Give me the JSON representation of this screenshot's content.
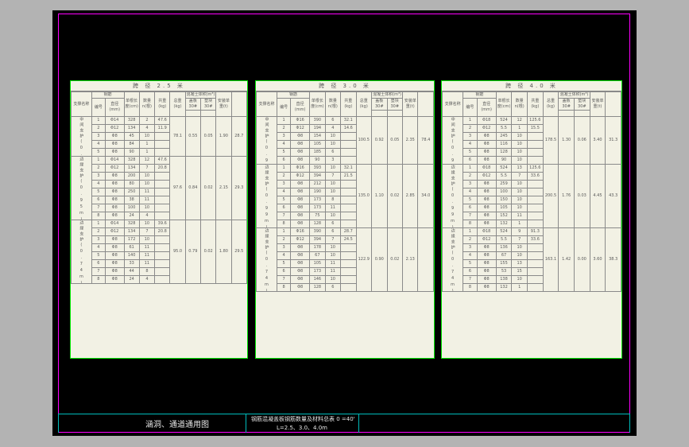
{
  "drawing": {
    "title": "涵洞、通道通用图",
    "subtitle_1": "钢筋混凝盖板钢筋数量及材料总表 0 =40'",
    "subtitle_2": "L=2.5、3.0、4.0m"
  },
  "headers": [
    "支撑名称",
    "钢筋",
    "编号",
    "直径(mm)",
    "单根长度(cm)",
    "数量n(根)",
    "共重(kg)",
    "总重(kg)",
    "混凝土体积(m³)",
    "盖板30#",
    "垫块30#",
    "安装单重(t)"
  ],
  "panels": [
    {
      "title": "跨 径 2.5 米",
      "groups": [
        {
          "name": "中间支护(0.99m)",
          "rows": [
            [
              "1",
              "Φ14",
              "328",
              "2"
            ],
            [
              "2",
              "Φ12",
              "134",
              "4"
            ],
            [
              "3",
              "Φ8",
              "45",
              "10"
            ],
            [
              "4",
              "Φ8",
              "84",
              "1"
            ],
            [
              "5",
              "Φ8",
              "90",
              "1"
            ]
          ],
          "gong": [
            "47.6",
            "11.9",
            "",
            "",
            ""
          ],
          "zong": "78.1",
          "c30": "0.55",
          "pad": "0.05",
          "unit": "1.90",
          "mid": "28.7"
        },
        {
          "name": "边缘支护(0.95m)",
          "rows": [
            [
              "1",
              "Φ14",
              "328",
              "12"
            ],
            [
              "2",
              "Φ12",
              "134",
              "7"
            ],
            [
              "3",
              "Φ8",
              "200",
              "10"
            ],
            [
              "4",
              "Φ8",
              "80",
              "10"
            ],
            [
              "5",
              "Φ8",
              "250",
              "11"
            ],
            [
              "6",
              "Φ8",
              "38",
              "11"
            ],
            [
              "7",
              "Φ8",
              "100",
              "10"
            ],
            [
              "8",
              "Φ8",
              "24",
              "4"
            ]
          ],
          "gong": [
            "47.6",
            "20.8",
            "",
            "",
            "",
            "",
            "",
            ""
          ],
          "zong": "97.6",
          "c30": "0.84",
          "pad": "0.02",
          "unit": "2.15",
          "mid": "29.3"
        },
        {
          "name": "边缘支护(0.74m)",
          "rows": [
            [
              "1",
              "Φ14",
              "328",
              "10"
            ],
            [
              "2",
              "Φ12",
              "134",
              "7"
            ],
            [
              "3",
              "Φ8",
              "172",
              "10"
            ],
            [
              "4",
              "Φ8",
              "61",
              "11"
            ],
            [
              "5",
              "Φ8",
              "140",
              "11"
            ],
            [
              "6",
              "Φ8",
              "33",
              "11"
            ],
            [
              "7",
              "Φ8",
              "44",
              "8"
            ],
            [
              "8",
              "Φ8",
              "24",
              "4"
            ]
          ],
          "gong": [
            "39.6",
            "20.8",
            "",
            "",
            "",
            "",
            "",
            ""
          ],
          "zong": "95.0",
          "c30": "0.79",
          "pad": "0.02",
          "unit": "1.80",
          "mid": "29.5"
        }
      ]
    },
    {
      "title": "跨 径 3.0 米",
      "groups": [
        {
          "name": "中间支护(0.99m)",
          "rows": [
            [
              "1",
              "Φ16",
              "390",
              "6"
            ],
            [
              "2",
              "Φ12",
              "194",
              "4"
            ],
            [
              "3",
              "Φ8",
              "154",
              "10"
            ],
            [
              "4",
              "Φ8",
              "105",
              "10"
            ],
            [
              "5",
              "Φ8",
              "185",
              "6"
            ],
            [
              "6",
              "Φ8",
              "90",
              "3"
            ]
          ],
          "gong": [
            "32.1",
            "14.6",
            "",
            "",
            "",
            ""
          ],
          "zong": "100.5",
          "c30": "0.92",
          "pad": "0.05",
          "unit": "2.35",
          "mid": "78.4"
        },
        {
          "name": "边缘支护(0.99m)",
          "rows": [
            [
              "1",
              "Φ16",
              "393",
              "10"
            ],
            [
              "2",
              "Φ12",
              "394",
              "7"
            ],
            [
              "3",
              "Φ8",
              "212",
              "10"
            ],
            [
              "4",
              "Φ8",
              "190",
              "10"
            ],
            [
              "5",
              "Φ8",
              "173",
              "8"
            ],
            [
              "6",
              "Φ8",
              "173",
              "11"
            ],
            [
              "7",
              "Φ8",
              "75",
              "10"
            ],
            [
              "8",
              "Φ8",
              "128",
              "6"
            ]
          ],
          "gong": [
            "32.1",
            "21.5",
            "",
            "",
            "",
            "",
            "",
            ""
          ],
          "zong": "135.0",
          "c30": "1.10",
          "pad": "0.02",
          "unit": "2.85",
          "mid": "34.0"
        },
        {
          "name": "边缘支护(0.74m)",
          "rows": [
            [
              "1",
              "Φ16",
              "390",
              "6"
            ],
            [
              "2",
              "Φ12",
              "394",
              "7"
            ],
            [
              "3",
              "Φ8",
              "178",
              "10"
            ],
            [
              "4",
              "Φ8",
              "67",
              "10"
            ],
            [
              "5",
              "Φ8",
              "105",
              "11"
            ],
            [
              "6",
              "Φ8",
              "173",
              "11"
            ],
            [
              "7",
              "Φ8",
              "146",
              "10"
            ],
            [
              "8",
              "Φ8",
              "128",
              "6"
            ]
          ],
          "gong": [
            "28.7",
            "24.5",
            "",
            "",
            "",
            "",
            "",
            ""
          ],
          "zong": "122.9",
          "c30": "0.90",
          "pad": "0.02",
          "unit": "2.13",
          "mid": ""
        }
      ]
    },
    {
      "title": "跨 径 4.0 米",
      "groups": [
        {
          "name": "中间支护(0.99m)",
          "rows": [
            [
              "1",
              "Φ18",
              "524",
              "12"
            ],
            [
              "2",
              "Φ12",
              "5.5",
              "1"
            ],
            [
              "3",
              "Φ8",
              "245",
              "10"
            ],
            [
              "4",
              "Φ8",
              "116",
              "10"
            ],
            [
              "5",
              "Φ8",
              "128",
              "10"
            ],
            [
              "6",
              "Φ8",
              "90",
              "10"
            ]
          ],
          "gong": [
            "125.6",
            "15.5",
            "",
            "",
            "",
            ""
          ],
          "zong": "178.5",
          "c30": "1.30",
          "pad": "0.06",
          "unit": "3.40",
          "mid": "31.3"
        },
        {
          "name": "边缘支护(0.99m)",
          "rows": [
            [
              "1",
              "Φ18",
              "524",
              "13"
            ],
            [
              "2",
              "Φ12",
              "5.5",
              "7"
            ],
            [
              "3",
              "Φ8",
              "259",
              "10"
            ],
            [
              "4",
              "Φ8",
              "100",
              "10"
            ],
            [
              "5",
              "Φ8",
              "150",
              "10"
            ],
            [
              "6",
              "Φ8",
              "105",
              "10"
            ],
            [
              "7",
              "Φ8",
              "152",
              "11"
            ],
            [
              "8",
              "Φ8",
              "132",
              "1"
            ]
          ],
          "gong": [
            "125.6",
            "33.6",
            "",
            "",
            "",
            "",
            "",
            ""
          ],
          "zong": "200.5",
          "c30": "1.76",
          "pad": "0.03",
          "unit": "4.45",
          "mid": "43.3"
        },
        {
          "name": "边缘支护(0.74m)",
          "rows": [
            [
              "1",
              "Φ18",
              "524",
              "9"
            ],
            [
              "2",
              "Φ12",
              "5.5",
              "7"
            ],
            [
              "3",
              "Φ8",
              "136",
              "10"
            ],
            [
              "4",
              "Φ8",
              "67",
              "10"
            ],
            [
              "5",
              "Φ8",
              "155",
              "13"
            ],
            [
              "6",
              "Φ8",
              "53",
              "15"
            ],
            [
              "7",
              "Φ8",
              "138",
              "10"
            ],
            [
              "8",
              "Φ8",
              "132",
              "1"
            ]
          ],
          "gong": [
            "91.3",
            "33.6",
            "",
            "",
            "",
            "",
            "",
            ""
          ],
          "zong": "163.1",
          "c30": "1.42",
          "pad": "0.00",
          "unit": "3.60",
          "mid": "38.3"
        }
      ]
    }
  ]
}
